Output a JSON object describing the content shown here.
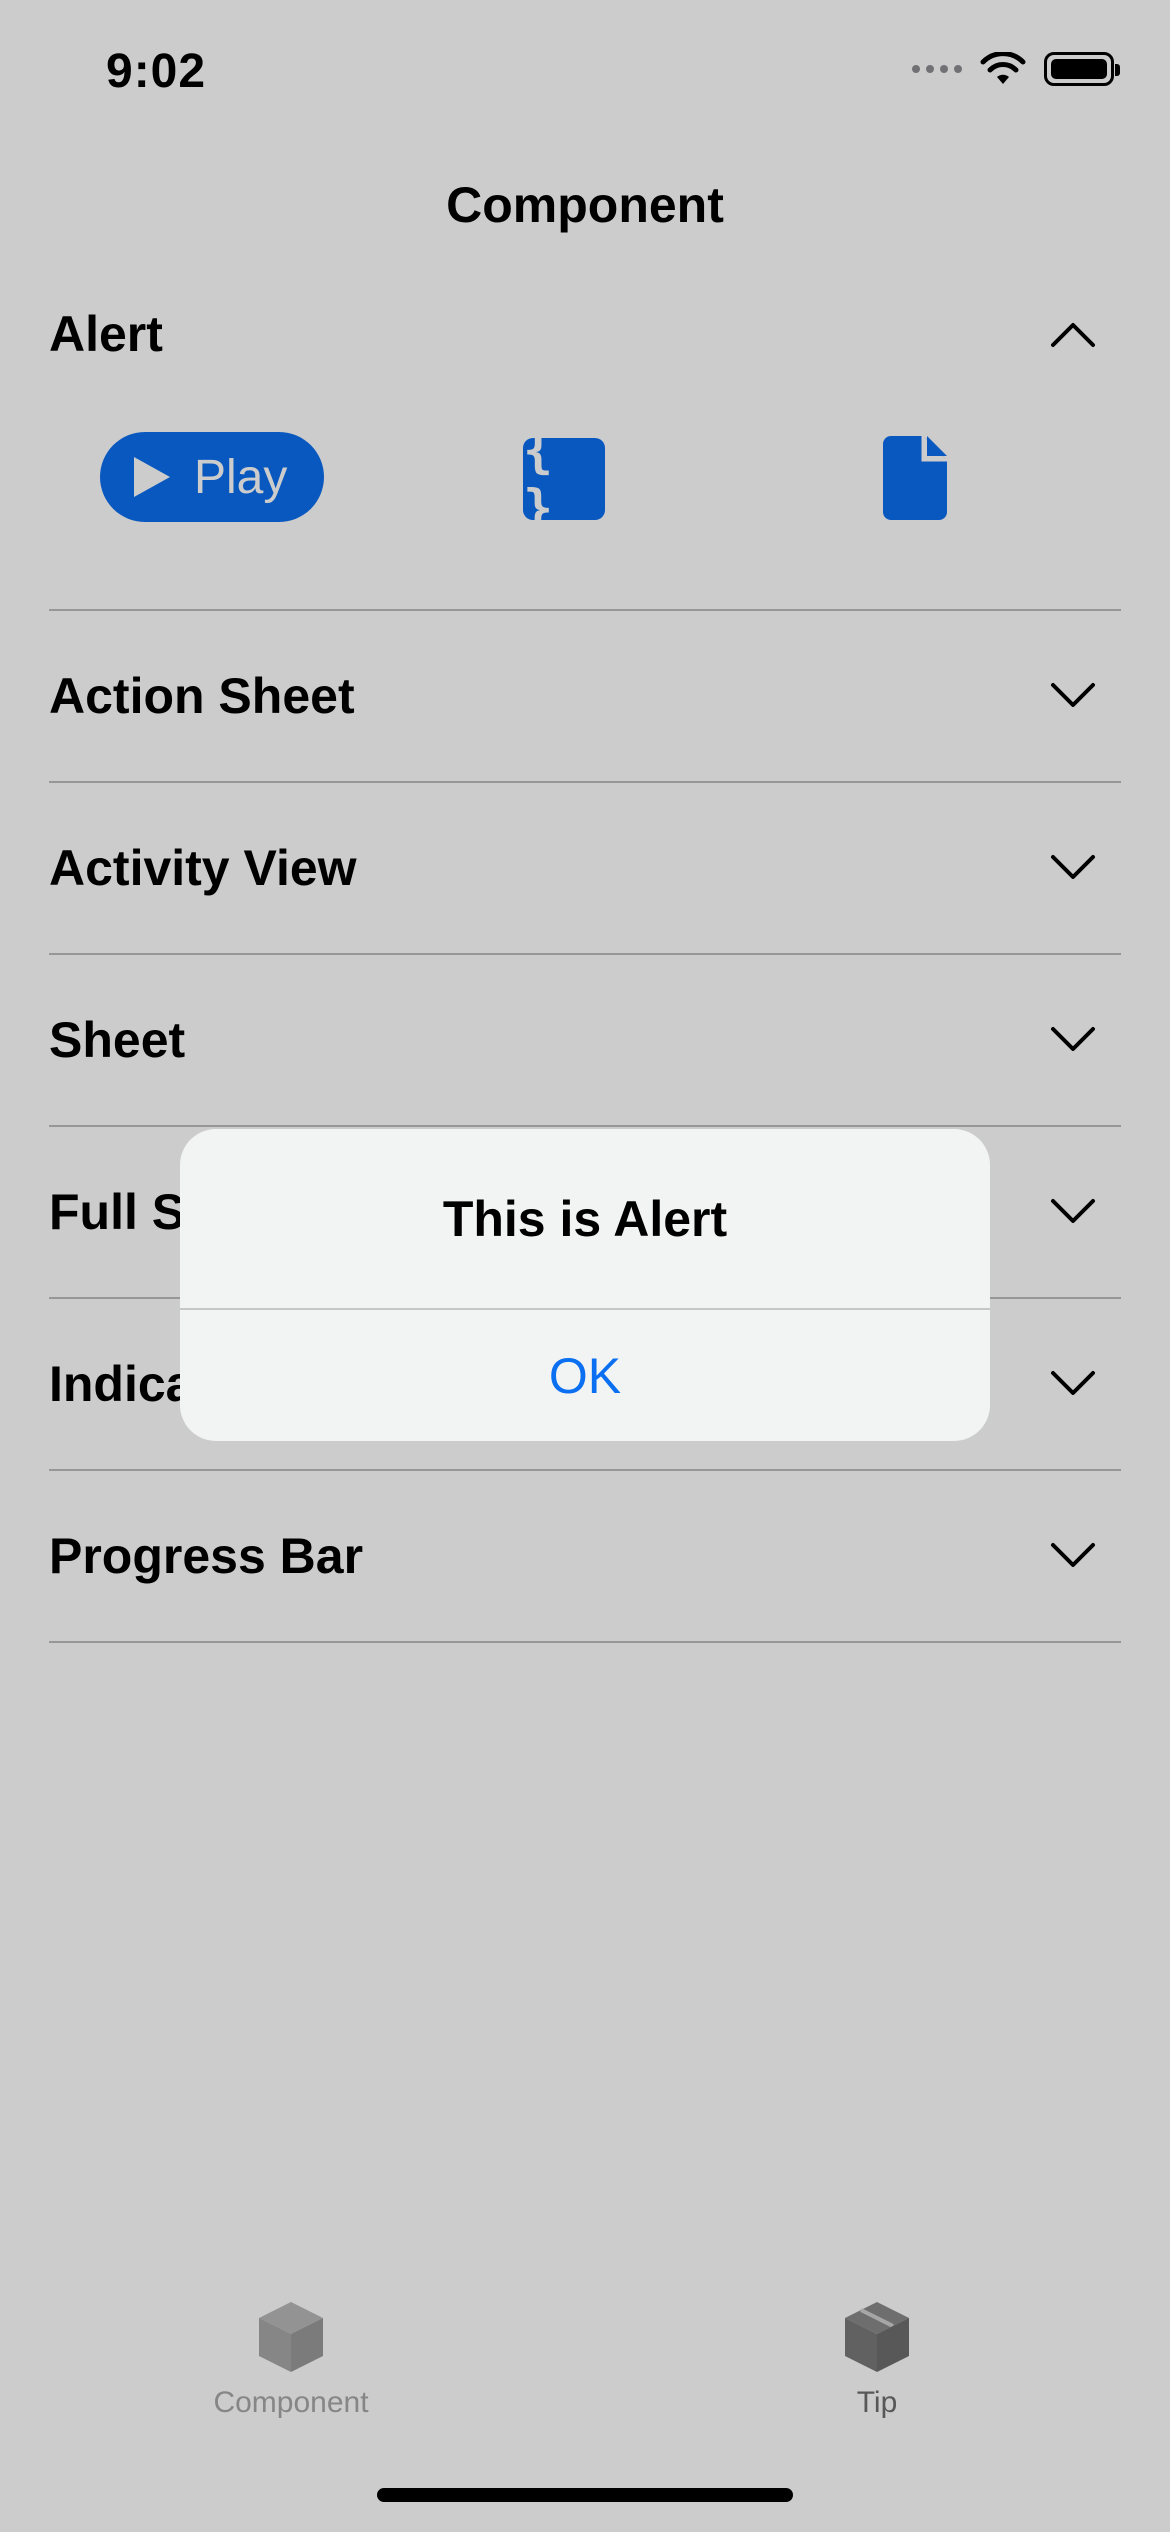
{
  "status_bar": {
    "time": "9:02"
  },
  "nav": {
    "title": "Component"
  },
  "list": {
    "items": [
      {
        "label": "Alert",
        "expanded": true
      },
      {
        "label": "Action Sheet",
        "expanded": false
      },
      {
        "label": "Activity View",
        "expanded": false
      },
      {
        "label": "Sheet",
        "expanded": false
      },
      {
        "label": "Full Screen Cover",
        "visible_label": "Full S",
        "expanded": false
      },
      {
        "label": "Indicator",
        "visible_label": "Indica",
        "expanded": false
      },
      {
        "label": "Progress Bar",
        "expanded": false
      }
    ]
  },
  "alert_actions": {
    "play_label": "Play",
    "code_icon": "braces-icon",
    "doc_icon": "document-icon"
  },
  "alert": {
    "title": "This is Alert",
    "ok_label": "OK"
  },
  "tab_bar": {
    "tabs": [
      {
        "label": "Component",
        "icon": "cube-icon",
        "selected": false
      },
      {
        "label": "Tip",
        "icon": "box-icon",
        "selected": true
      }
    ]
  },
  "colors": {
    "accent": "#0A6FF0",
    "background": "#FFFFFF",
    "dimmed_background": "#CCCCCC",
    "alert_background": "#F2F3F3",
    "tab_inactive": "#A8A8A8",
    "tab_active": "#6E6E6E"
  }
}
